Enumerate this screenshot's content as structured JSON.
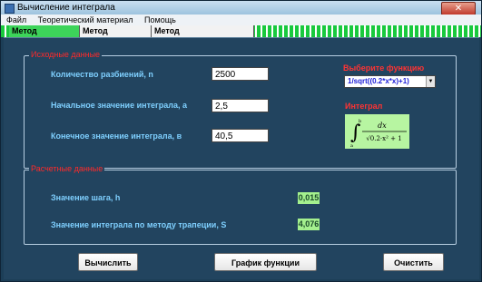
{
  "window": {
    "title": "Вычисление интеграла",
    "close_label": "✕"
  },
  "menu": [
    "Файл",
    "Теоретический материал",
    "Помощь"
  ],
  "tabs": [
    "Метод трапеции",
    "Метод Симпсона",
    "Метод прямоугольников"
  ],
  "input_group": {
    "title": "Исходные данные",
    "partitions_label": "Количество разбиений, n",
    "partitions_value": "2500",
    "start_label": "Начальное значение интеграла, а",
    "start_value": "2,5",
    "end_label": "Конечное значение интеграла, в",
    "end_value": "40,5"
  },
  "function": {
    "select_label": "Выберите функцию",
    "selected": "1/sqrt((0.2*x*x)+1)",
    "integral_label": "Интеграл",
    "formula": {
      "upper": "b",
      "lower": "a",
      "numerator": "dx",
      "denominator": "√0.2·x² + 1"
    }
  },
  "results_group": {
    "title": "Расчетные данные",
    "step_label": "Значение шага, h",
    "step_value": "0,015",
    "integral_label": "Значение интеграла по методу трапеции, S",
    "integral_value": "4,076"
  },
  "buttons": {
    "calculate": "Вычислить",
    "plot": "График функции",
    "clear": "Очистить"
  }
}
